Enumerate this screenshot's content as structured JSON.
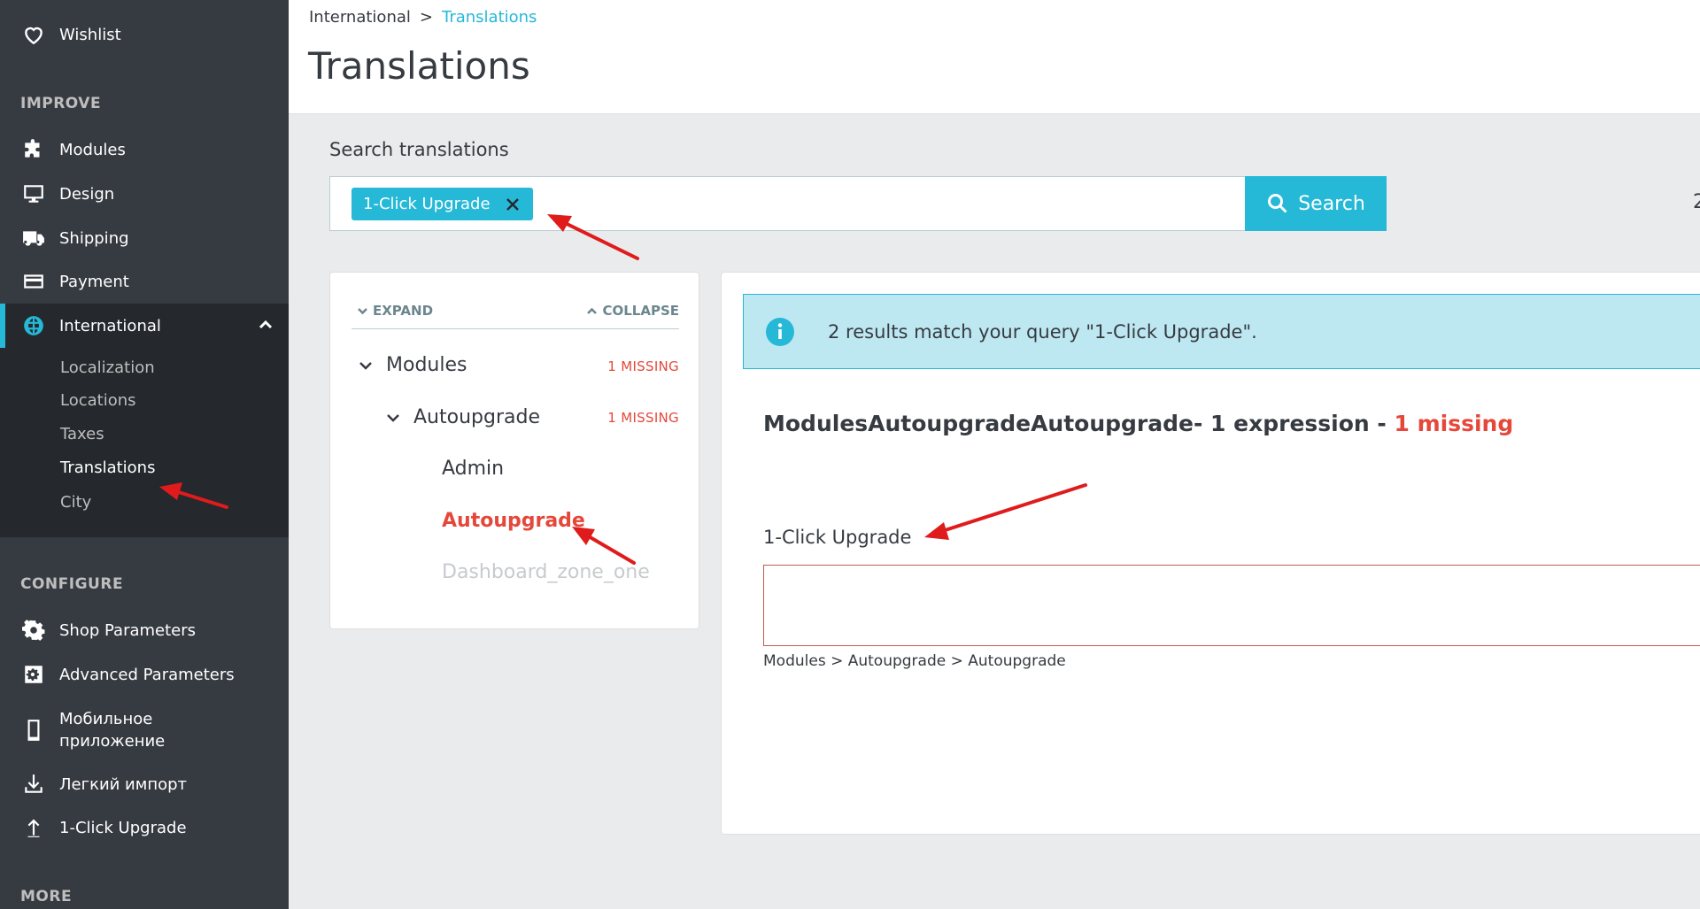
{
  "sidebar": {
    "top_items": [
      {
        "label": "Wishlist",
        "icon": "heart-icon"
      }
    ],
    "improve": {
      "title": "IMPROVE",
      "items": [
        {
          "label": "Modules",
          "icon": "puzzle-icon"
        },
        {
          "label": "Design",
          "icon": "monitor-icon"
        },
        {
          "label": "Shipping",
          "icon": "truck-icon"
        },
        {
          "label": "Payment",
          "icon": "credit-card-icon"
        },
        {
          "label": "International",
          "icon": "globe-icon"
        }
      ],
      "international_submenu": [
        "Localization",
        "Locations",
        "Taxes",
        "Translations",
        "City"
      ]
    },
    "configure": {
      "title": "CONFIGURE",
      "items": [
        {
          "label": "Shop Parameters",
          "icon": "gear-icon"
        },
        {
          "label": "Advanced Parameters",
          "icon": "cog-box-icon"
        },
        {
          "label_line1": "Мобильное",
          "label_line2": "приложение",
          "icon": "mobile-icon"
        },
        {
          "label": "Легкий импорт",
          "icon": "download-icon"
        },
        {
          "label": "1-Click Upgrade",
          "icon": "upload-icon"
        }
      ]
    },
    "more": {
      "title": "MORE"
    }
  },
  "header": {
    "breadcrumb": {
      "parent": "International",
      "separator": ">",
      "current": "Translations"
    },
    "title": "Translations"
  },
  "search": {
    "label": "Search translations",
    "chip": "1-Click Upgrade",
    "button_label": "Search",
    "right_edge_text": "2"
  },
  "tree": {
    "expand_label": "EXPAND",
    "collapse_label": "COLLAPSE",
    "nodes": [
      {
        "label": "Modules",
        "missing": "1 MISSING"
      },
      {
        "label": "Autoupgrade",
        "missing": "1 MISSING"
      },
      {
        "label": "Admin"
      },
      {
        "label": "Autoupgrade"
      },
      {
        "label": "Dashboard_zone_one"
      }
    ]
  },
  "results": {
    "alert": "2 results match your query \"1-Click Upgrade\".",
    "domain_title": "ModulesAutoupgradeAutoupgrade- 1 expression - ",
    "domain_missing": "1 missing",
    "field_label": "1-Click Upgrade",
    "field_value": "",
    "field_path": "Modules > Autoupgrade > Autoupgrade"
  },
  "colors": {
    "sidebar_bg": "#363a41",
    "submenu_bg": "#25282d",
    "accent": "#25b9d7",
    "missing": "#e5483b",
    "alert_bg": "#bee8f1"
  }
}
